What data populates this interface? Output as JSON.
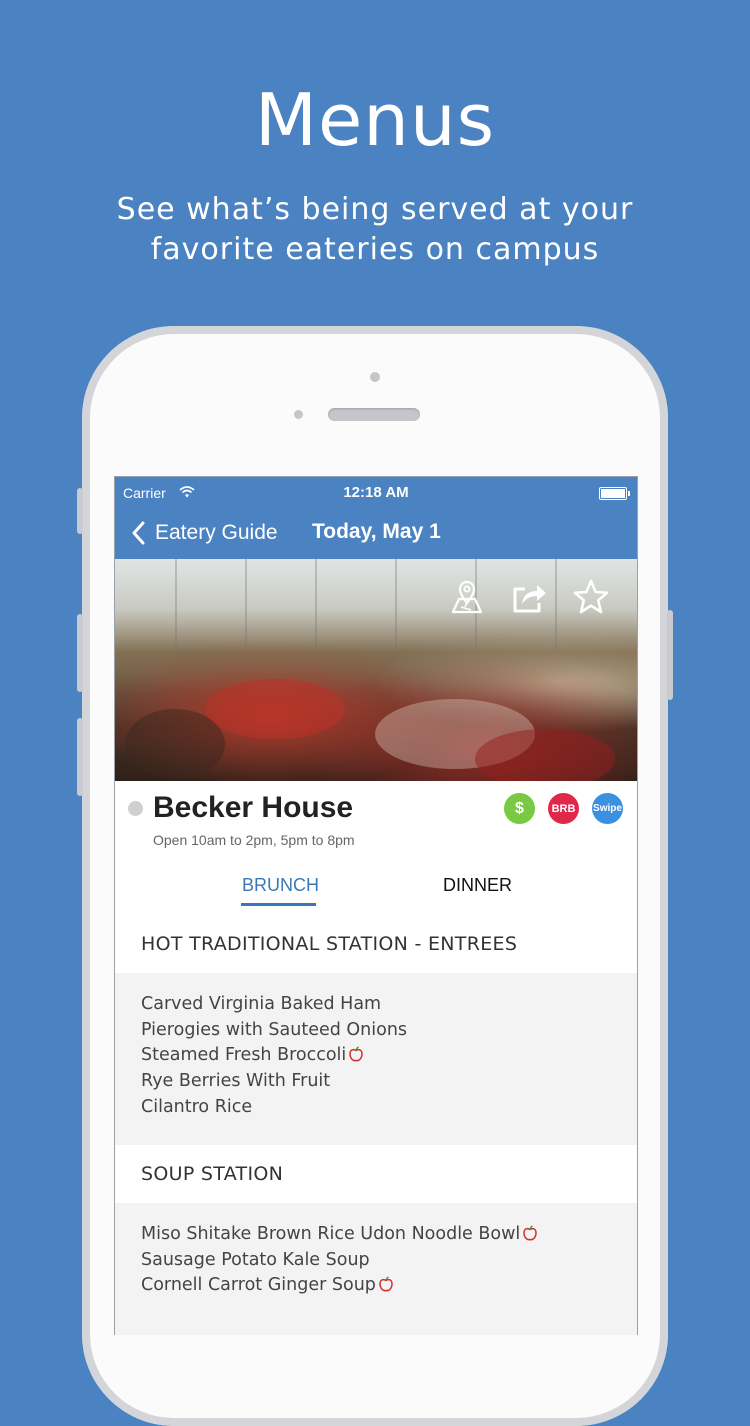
{
  "promo": {
    "title": "Menus",
    "subtitle": "See what’s being served at your favorite eateries on campus"
  },
  "status_bar": {
    "carrier": "Carrier",
    "time": "12:18 AM"
  },
  "nav": {
    "back_label": "Eatery Guide",
    "title": "Today, May 1"
  },
  "hero": {
    "actions": [
      "map-pin-icon",
      "share-icon",
      "star-icon"
    ]
  },
  "eatery": {
    "name": "Becker House",
    "hours": "Open 10am to 2pm, 5pm to 8pm",
    "payments": [
      {
        "label": "$",
        "color": "#7ac943"
      },
      {
        "label": "BRB",
        "color": "#e0284b"
      },
      {
        "label": "Swipe",
        "color": "#3d8fe0"
      }
    ]
  },
  "tabs": {
    "brunch": "BRUNCH",
    "dinner": "DINNER",
    "selected": "BRUNCH"
  },
  "sections": [
    {
      "title": "HOT TRADITIONAL STATION - ENTREES",
      "items": [
        {
          "name": "Carved Virginia Baked Ham",
          "healthy": false
        },
        {
          "name": "Pierogies with Sauteed Onions",
          "healthy": false
        },
        {
          "name": "Steamed Fresh Broccoli",
          "healthy": true
        },
        {
          "name": "Rye Berries With Fruit",
          "healthy": false
        },
        {
          "name": "Cilantro Rice",
          "healthy": false
        }
      ]
    },
    {
      "title": "SOUP STATION",
      "items": [
        {
          "name": "Miso Shitake Brown Rice Udon Noodle Bowl",
          "healthy": true
        },
        {
          "name": "Sausage Potato Kale Soup",
          "healthy": false
        },
        {
          "name": "Cornell Carrot Ginger Soup",
          "healthy": true
        }
      ]
    }
  ],
  "colors": {
    "background": "#4a82c2",
    "navbar": "#4a82c2",
    "tab_active": "#3c78b8",
    "healthy_icon": "#d32f2f"
  }
}
